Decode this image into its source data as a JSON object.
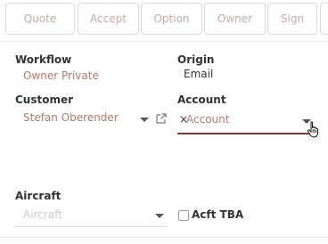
{
  "tabs": [
    {
      "label": "Quote"
    },
    {
      "label": "Accept"
    },
    {
      "label": "Option"
    },
    {
      "label": "Owner"
    },
    {
      "label": "Sign"
    }
  ],
  "workflow": {
    "label": "Workflow",
    "value": "Owner Private"
  },
  "origin": {
    "label": "Origin",
    "value": "Email"
  },
  "customer": {
    "label": "Customer",
    "value": "Stefan Oberender"
  },
  "account": {
    "label": "Account",
    "clear_glyph": "×",
    "placeholder": "Account"
  },
  "aircraft": {
    "label": "Aircraft",
    "placeholder": "Aircraft"
  },
  "acft_tba": {
    "label": "Acft TBA",
    "checked": false
  },
  "colors": {
    "accent": "#b07a6a",
    "active_underline": "#9b2c2c"
  }
}
